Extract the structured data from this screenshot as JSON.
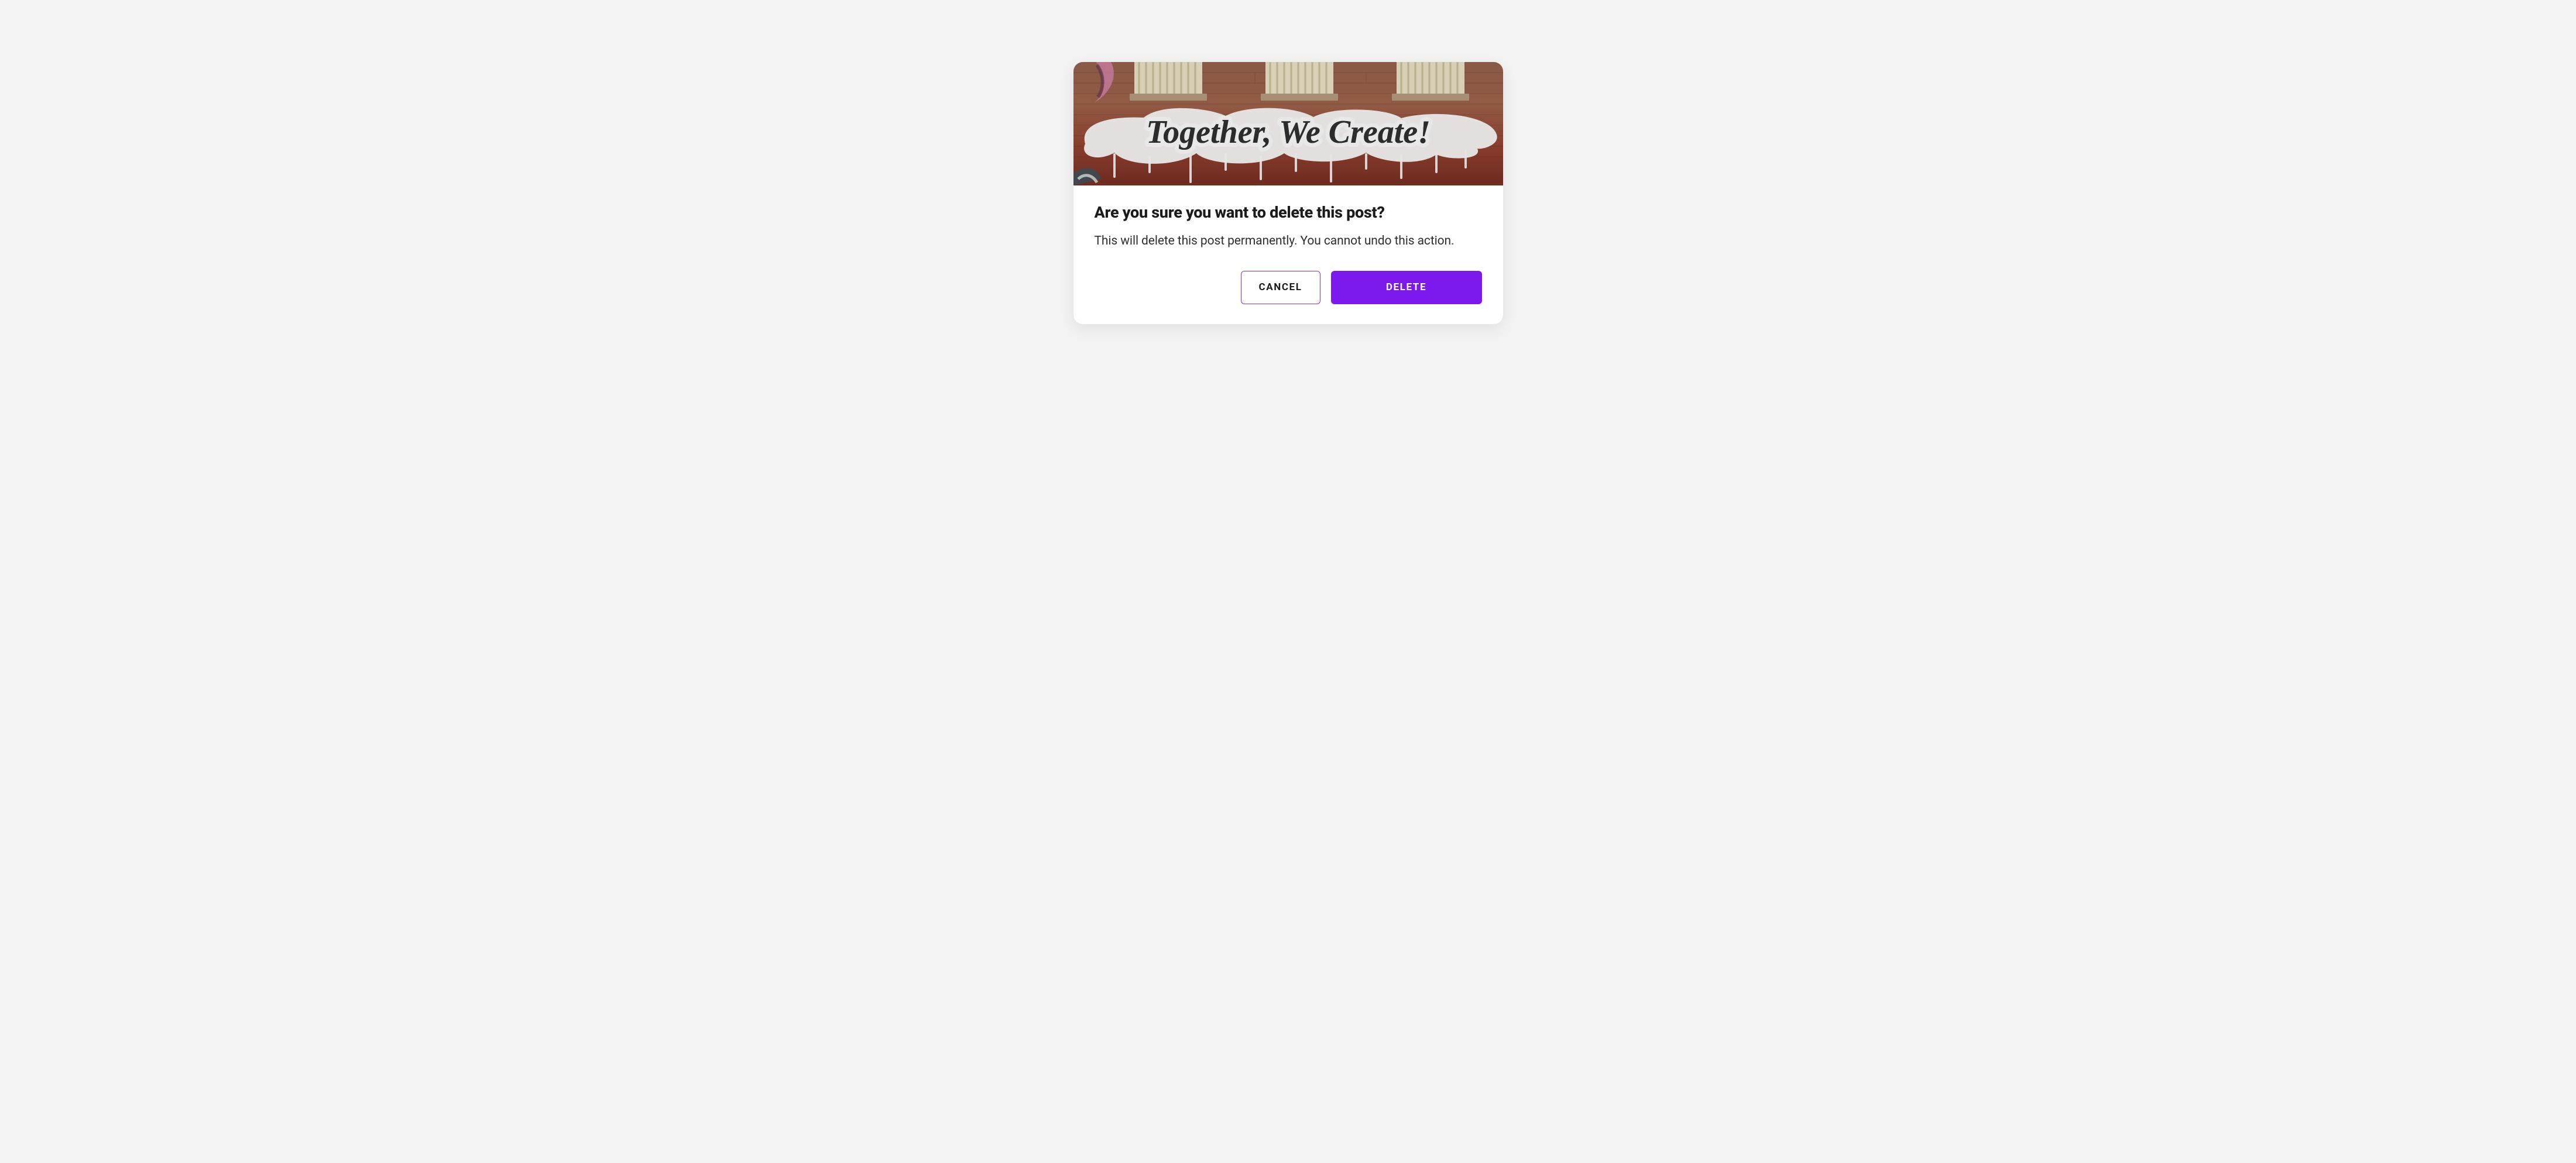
{
  "dialog": {
    "image_caption": "Together, We Create!",
    "title": "Are you sure you want to delete this post?",
    "body": "This will delete this post permanently. You cannot undo this action.",
    "cancel_label": "CANCEL",
    "confirm_label": "DELETE",
    "colors": {
      "accent": "#7b19ef",
      "page_bg": "#f3f3f4",
      "text_primary": "#1b1b1c"
    }
  }
}
